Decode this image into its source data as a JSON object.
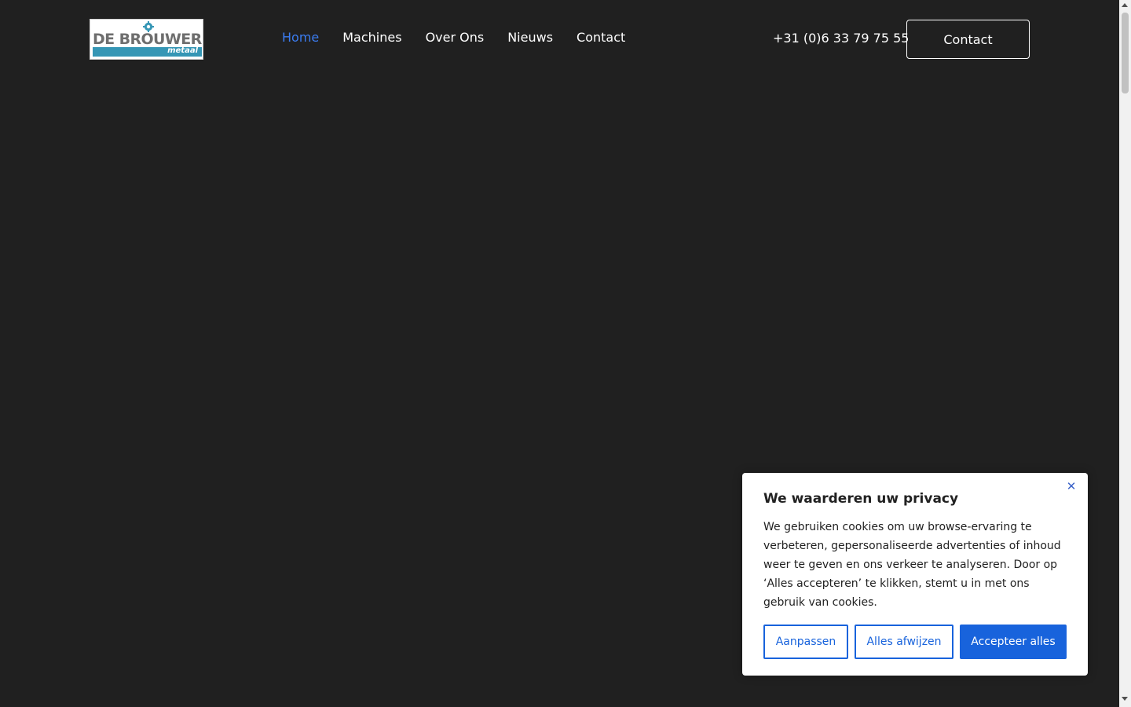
{
  "brand": {
    "logo_text": "DE BROUWER",
    "logo_subtext": "metaal"
  },
  "nav": {
    "items": [
      {
        "label": "Home",
        "active": true
      },
      {
        "label": "Machines",
        "active": false
      },
      {
        "label": "Over Ons",
        "active": false
      },
      {
        "label": "Nieuws",
        "active": false
      },
      {
        "label": "Contact",
        "active": false
      }
    ],
    "phone": "+31 (0)6 33 79 75 55",
    "contact_button": "Contact"
  },
  "cookie_banner": {
    "title": "We waarderen uw privacy",
    "body": "We gebruiken cookies om uw browse-ervaring te verbeteren, gepersonaliseerde advertenties of inhoud weer te geven en ons verkeer te analyseren. Door op ‘Alles accepteren’ te klikken, stemt u in met ons gebruik van cookies.",
    "close_symbol": "✕",
    "buttons": {
      "customize": "Aanpassen",
      "reject": "Alles afwijzen",
      "accept": "Accepteer alles"
    }
  },
  "colors": {
    "background": "#202020",
    "nav_active": "#3b7cf0",
    "logo_accent": "#3596b5",
    "cookie_primary": "#1863dc"
  },
  "icons": {
    "close": "close-icon",
    "logo_gear": "gear-icon"
  }
}
